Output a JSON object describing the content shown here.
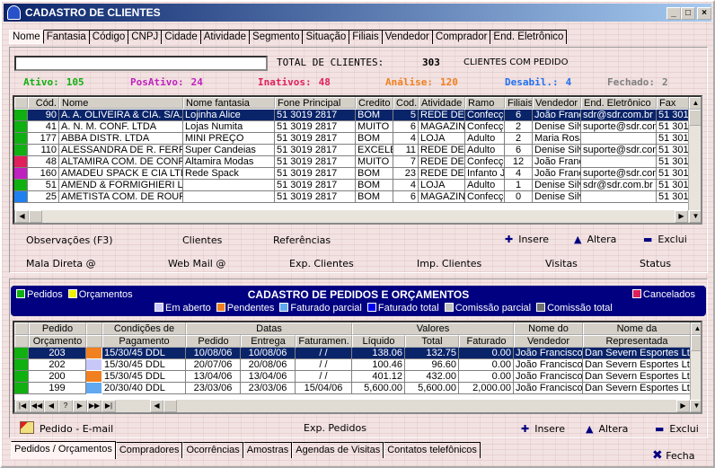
{
  "window": {
    "title": "CADASTRO DE CLIENTES",
    "controls": [
      "_",
      "□",
      "×"
    ]
  },
  "search_tabs": [
    "Nome",
    "Fantasia",
    "Código",
    "CNPJ",
    "Cidade",
    "Atividade",
    "Segmento",
    "Situação",
    "Filiais",
    "Vendedor",
    "Comprador",
    "End. Eletrônico"
  ],
  "search": {
    "value": "",
    "total_label": "TOTAL DE CLIENTES:",
    "total_value": "303",
    "with_orders_label": "CLIENTES COM PEDIDO"
  },
  "status_counts": [
    {
      "label": "Ativo:",
      "value": "105",
      "color": "#10b010"
    },
    {
      "label": "PosAtivo:",
      "value": "24",
      "color": "#c020c0"
    },
    {
      "label": "Inativos:",
      "value": "48",
      "color": "#e0205a"
    },
    {
      "label": "Análise:",
      "value": "120",
      "color": "#f08020"
    },
    {
      "label": "Desabil.:",
      "value": "4",
      "color": "#2070f0"
    },
    {
      "label": "Fechado:",
      "value": "2",
      "color": "#808080"
    }
  ],
  "clients_grid": {
    "columns": [
      "",
      "Cód.",
      "Nome",
      "Nome fantasia",
      "Fone Principal",
      "Credito",
      "Cod.",
      "Atividade",
      "Ramo",
      "Filiais",
      "Vendedor",
      "End. Eletrônico",
      "Fax"
    ],
    "rows": [
      {
        "status": "#10b010",
        "cells": [
          "90",
          "A. A. OLIVEIRA & CIA. S/A.",
          "Lojinha Alice",
          "51 3019 2817",
          "BOM",
          "5",
          "REDE DE",
          "Confecçõ",
          "6",
          "João Franc",
          "sdr@sdr.com.br",
          "51 3019"
        ]
      },
      {
        "status": "#10b010",
        "cells": [
          "41",
          "A. N. M. CONF. LTDA",
          "Lojas Numita",
          "51 3019 2817",
          "MUITO B",
          "6",
          "MAGAZINE",
          "Confecçõ",
          "2",
          "Denise Silv",
          "suporte@sdr.com",
          "51 3019"
        ]
      },
      {
        "status": "#10b010",
        "cells": [
          "177",
          "ABBA DISTR. LTDA",
          "MINI PREÇO",
          "51 3019 2817",
          "BOM",
          "4",
          "LOJA",
          "Adulto",
          "2",
          "Maria Rosá",
          "",
          "51 3019"
        ]
      },
      {
        "status": "#10b010",
        "cells": [
          "110",
          "ALESSANDRA DE R. FERR",
          "Super Candeias",
          "51 3019 2817",
          "EXCELE",
          "11",
          "REDE DE",
          "Adulto",
          "6",
          "Denise Silv",
          "suporte@sdr.com",
          "51 3019"
        ]
      },
      {
        "status": "#e0205a",
        "cells": [
          "48",
          "ALTAMIRA COM. DE CONF",
          "Altamira Modas",
          "51 3019 2817",
          "MUITO B",
          "7",
          "REDE DE",
          "Confecçõ",
          "12",
          "João Franc",
          "",
          "51 3019"
        ]
      },
      {
        "status": "#c020c0",
        "cells": [
          "160",
          "AMADEU SPACK E CIA LTD",
          "Rede Spack",
          "51 3019 2817",
          "BOM",
          "23",
          "REDE DE",
          "Infanto Ju",
          "4",
          "João Franc",
          "suporte@sdr.com",
          "51 3019"
        ]
      },
      {
        "status": "#10b010",
        "cells": [
          "51",
          "AMEND & FORMIGHIERI LT",
          "",
          "51 3019 2817",
          "BOM",
          "4",
          "LOJA",
          "Adulto",
          "1",
          "Denise Silv",
          "sdr@sdr.com.br",
          "51 3019"
        ]
      },
      {
        "status": "#2080f0",
        "cells": [
          "25",
          "AMETISTA COM. DE ROUP",
          "",
          "51 3019 2817",
          "BOM",
          "6",
          "MAGAZINE",
          "Confecçõ",
          "0",
          "Denise Silv",
          "",
          "51 3019"
        ]
      }
    ]
  },
  "client_actions": {
    "row1": [
      "Observações (F3)",
      "Clientes",
      "Referências"
    ],
    "row2": [
      "Mala Direta @",
      "Web Mail @",
      "Exp. Clientes",
      "Imp. Clientes",
      "Visitas",
      "Status"
    ],
    "insert": "Insere",
    "edit": "Altera",
    "delete": "Exclui"
  },
  "orders_banner": {
    "title": "CADASTRO DE PEDIDOS E ORÇAMENTOS",
    "left_legend": [
      {
        "label": "Pedidos",
        "color": "#10b010"
      },
      {
        "label": "Orçamentos",
        "color": "#f0f000"
      }
    ],
    "right_legend": {
      "label": "Cancelados",
      "color": "#e0205a"
    },
    "status_legend": [
      {
        "label": "Em aberto",
        "color": "#c8c8f8"
      },
      {
        "label": "Pendentes",
        "color": "#f08020"
      },
      {
        "label": "Faturado parcial",
        "color": "#60a8f0"
      },
      {
        "label": "Faturado total",
        "color": "#0000f0"
      },
      {
        "label": "Comissão parcial",
        "color": "#c0c0c0"
      },
      {
        "label": "Comissão total",
        "color": "#707070"
      }
    ]
  },
  "orders_grid": {
    "group_headers": {
      "pedido": "Pedido",
      "condicoes": "Condições de",
      "datas": "Datas",
      "valores": "Valores",
      "vendedor": "Nome do",
      "representada": "Nome da"
    },
    "columns": [
      "Orçamento",
      "Pagamento",
      "Pedido",
      "Entrega",
      "Faturamen.",
      "Líquido",
      "Total",
      "Faturado",
      "Vendedor",
      "Representada"
    ],
    "rows": [
      {
        "type": "#10b010",
        "status": "#f08020",
        "cells": [
          "203",
          "15/30/45 DDL",
          "10/08/06",
          "10/08/06",
          "/  /",
          "138.06",
          "132.75",
          "0.00",
          "João Francisco",
          "Dan Severn Esportes Ltda"
        ]
      },
      {
        "type": "#10b010",
        "status": "#c8c8f8",
        "cells": [
          "202",
          "15/30/45 DDL",
          "20/07/06",
          "20/08/06",
          "/  /",
          "100.46",
          "96.60",
          "0.00",
          "João Francisco",
          "Dan Severn Esportes Ltda"
        ]
      },
      {
        "type": "#10b010",
        "status": "#f08020",
        "cells": [
          "200",
          "15/30/45 DDL",
          "13/04/06",
          "13/04/06",
          "/  /",
          "401.12",
          "432.00",
          "0.00",
          "João Francisco",
          "Dan Severn Esportes Ltda"
        ]
      },
      {
        "type": "#10b010",
        "status": "#60a8f0",
        "cells": [
          "199",
          "20/30/40 DDL",
          "23/03/06",
          "23/03/06",
          "15/04/06",
          "5,600.00",
          "5,600.00",
          "2,000.00",
          "João Francisco",
          "Dan Severn Esportes Ltda"
        ]
      }
    ],
    "navigator": [
      "|◀",
      "◀◀",
      "◀",
      "?",
      "▶",
      "▶▶",
      "▶|"
    ]
  },
  "order_actions": {
    "email": "Pedido - E-mail",
    "export": "Exp. Pedidos",
    "insert": "Insere",
    "edit": "Altera",
    "delete": "Exclui"
  },
  "bottom_tabs": [
    "Pedidos / Orçamentos",
    "Compradores",
    "Ocorrências",
    "Amostras",
    "Agendas de Visitas",
    "Contatos telefônicos"
  ],
  "close_label": "Fecha"
}
